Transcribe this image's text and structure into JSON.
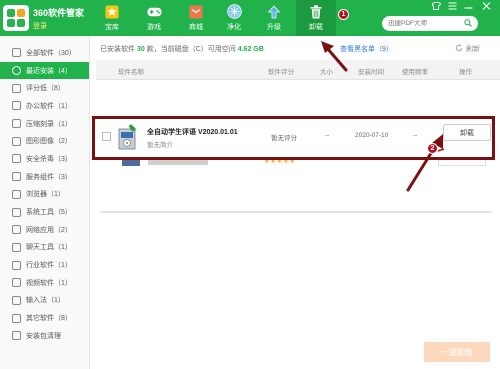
{
  "app": {
    "title": "360软件管家",
    "login": "登录"
  },
  "nav": [
    {
      "label": "宝库",
      "icon": "star-icon"
    },
    {
      "label": "游戏",
      "icon": "gamepad-icon"
    },
    {
      "label": "商城",
      "icon": "mail-icon"
    },
    {
      "label": "净化",
      "icon": "shield-icon"
    },
    {
      "label": "升级",
      "icon": "upgrade-icon"
    },
    {
      "label": "卸载",
      "icon": "trash-icon"
    }
  ],
  "search": {
    "placeholder": "迅捷PDF大师"
  },
  "sidebar": {
    "items": [
      {
        "label": "全部软件（30）"
      },
      {
        "label": "最近安装（4）"
      },
      {
        "label": "评分低（8）"
      },
      {
        "label": "办公软件（1）"
      },
      {
        "label": "压缩刻录（1）"
      },
      {
        "label": "图形图像（2）"
      },
      {
        "label": "安全杀毒（3）"
      },
      {
        "label": "服务组件（3）"
      },
      {
        "label": "浏览器（1）"
      },
      {
        "label": "系统工具（5）"
      },
      {
        "label": "网络应用（2）"
      },
      {
        "label": "聊天工具（1）"
      },
      {
        "label": "行业软件（1）"
      },
      {
        "label": "视频软件（1）"
      },
      {
        "label": "输入法（1）"
      },
      {
        "label": "其它软件（8）"
      },
      {
        "label": "安装包清理"
      }
    ]
  },
  "info": {
    "prefix": "已安装软件",
    "count": "30",
    "mid": "款，当前磁盘（C）可用空间",
    "space": "4.62 GB",
    "blacklist": "查看黑名单（9）",
    "refresh": "刷新"
  },
  "table": {
    "headers": [
      "软件名称",
      "软件评分",
      "大小",
      "安装时间",
      "使用频率",
      "操作"
    ]
  },
  "row": {
    "name": "全自动学生评语 V2020.01.01",
    "desc": "暂无简介",
    "rating": "暂无评分",
    "size": "--",
    "date": "2020-07-10",
    "freq": "--",
    "action": "卸载"
  },
  "partial_row": {
    "stars": "★★★★★"
  },
  "footer": {
    "batch_uninstall": "一键卸载"
  },
  "badges": [
    "1",
    "2"
  ],
  "colors": {
    "brand": "#22b24c",
    "annotation": "#7a1010"
  }
}
